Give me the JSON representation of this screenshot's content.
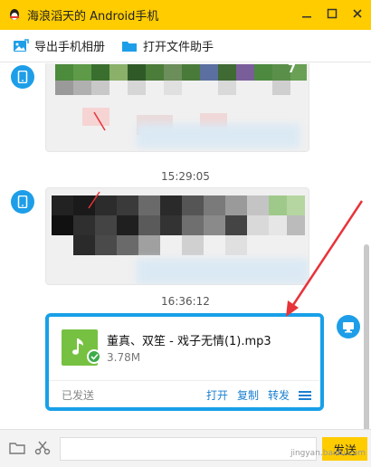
{
  "window": {
    "title": "海浪滔天的 Android手机"
  },
  "toolbar": {
    "export_album": "导出手机相册",
    "open_file_helper": "打开文件助手"
  },
  "chat": {
    "timestamps": [
      "15:29:05",
      "16:36:12"
    ],
    "first_image_badge": "7"
  },
  "file_message": {
    "name": "董真、双笙 - 戏子无情(1).mp3",
    "size": "3.78M",
    "status": "已发送",
    "actions": {
      "open": "打开",
      "copy": "复制",
      "forward": "转发"
    }
  },
  "bottom": {
    "send_label": "发送"
  },
  "watermark": "jingyan.baidu.com",
  "colors": {
    "titlebar": "#ffcc00",
    "accent": "#18a0e8",
    "file_icon": "#77c142",
    "send": "#ffcc00",
    "arrow": "#e8333a"
  },
  "icons": {
    "qq": "qq-penguin-icon",
    "minimize": "minimize-icon",
    "maximize": "maximize-icon",
    "close": "close-icon",
    "export": "image-export-icon",
    "folder": "folder-icon",
    "phone": "phone-icon",
    "monitor": "monitor-icon",
    "music": "music-note-icon",
    "check": "check-icon",
    "menu": "menu-icon",
    "scissors": "scissors-icon"
  }
}
